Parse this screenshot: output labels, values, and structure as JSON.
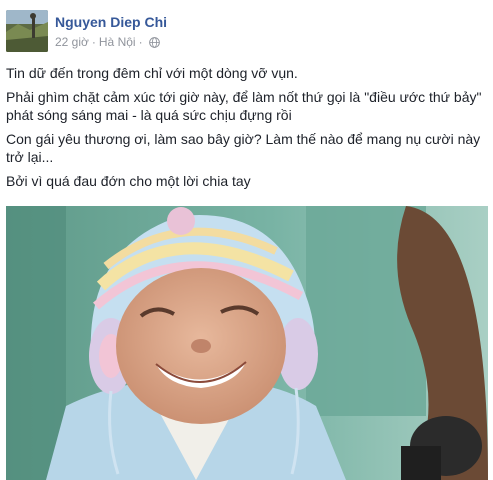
{
  "post": {
    "author": "Nguyen Diep Chi",
    "time": "22 giờ",
    "separator": "·",
    "location": "Hà Nội",
    "privacy_icon": "globe-icon",
    "paragraphs": [
      "Tin dữ đến trong đêm chỉ với một dòng vỡ vụn.",
      "Phải ghìm chặt cảm xúc tới giờ này, để làm nốt thứ gọi là \"điều ước thứ bảy\" phát sóng sáng mai - là quá sức chịu đựng rồi",
      "Con gái yêu thương ơi, làm sao bây giờ? Làm thế nào để mang nụ cười này trở lại...",
      "Bởi vì quá đau đớn cho một lời chia tay"
    ]
  },
  "colors": {
    "author": "#365899",
    "meta": "#90949c",
    "text": "#1d2129",
    "hat": "#b9d8ee",
    "background_green": "#6fa99a"
  }
}
